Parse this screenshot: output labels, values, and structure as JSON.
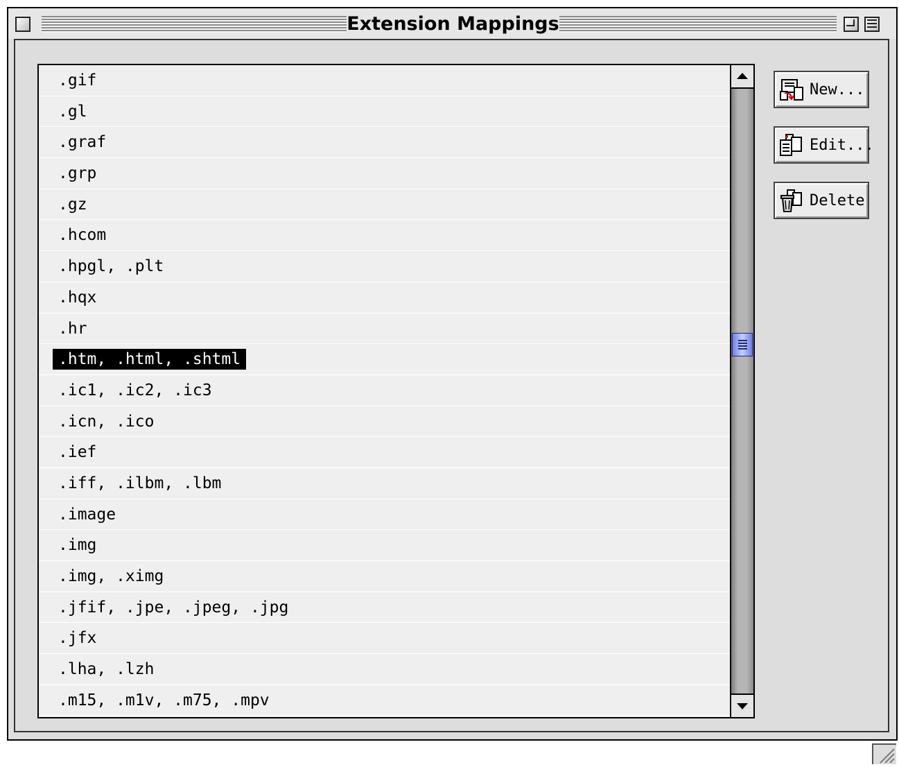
{
  "window": {
    "title": "Extension Mappings",
    "controls": {
      "close": "close-box",
      "zoom": "zoom-box",
      "collapse": "collapse-box"
    }
  },
  "list": {
    "selected_index": 9,
    "items": [
      ".gif",
      ".gl",
      ".graf",
      ".grp",
      ".gz",
      ".hcom",
      ".hpgl, .plt",
      ".hqx",
      ".hr",
      ".htm, .html, .shtml",
      ".ic1, .ic2, .ic3",
      ".icn, .ico",
      ".ief",
      ".iff, .ilbm, .lbm",
      ".image",
      ".img",
      ".img, .ximg",
      ".jfif, .jpe, .jpeg, .jpg",
      ".jfx",
      ".lha, .lzh",
      ".m15, .m1v, .m75, .mpv"
    ]
  },
  "scrollbar": {
    "thumb_position": 0.42
  },
  "buttons": {
    "new_label": "New...",
    "edit_label": "Edit...",
    "delete_label": "Delete"
  },
  "colors": {
    "window_bg": "#dddddd",
    "list_bg": "#efefef",
    "selection_bg": "#000000",
    "selection_text": "#ffffff",
    "scroll_thumb": "#8a98f0"
  }
}
